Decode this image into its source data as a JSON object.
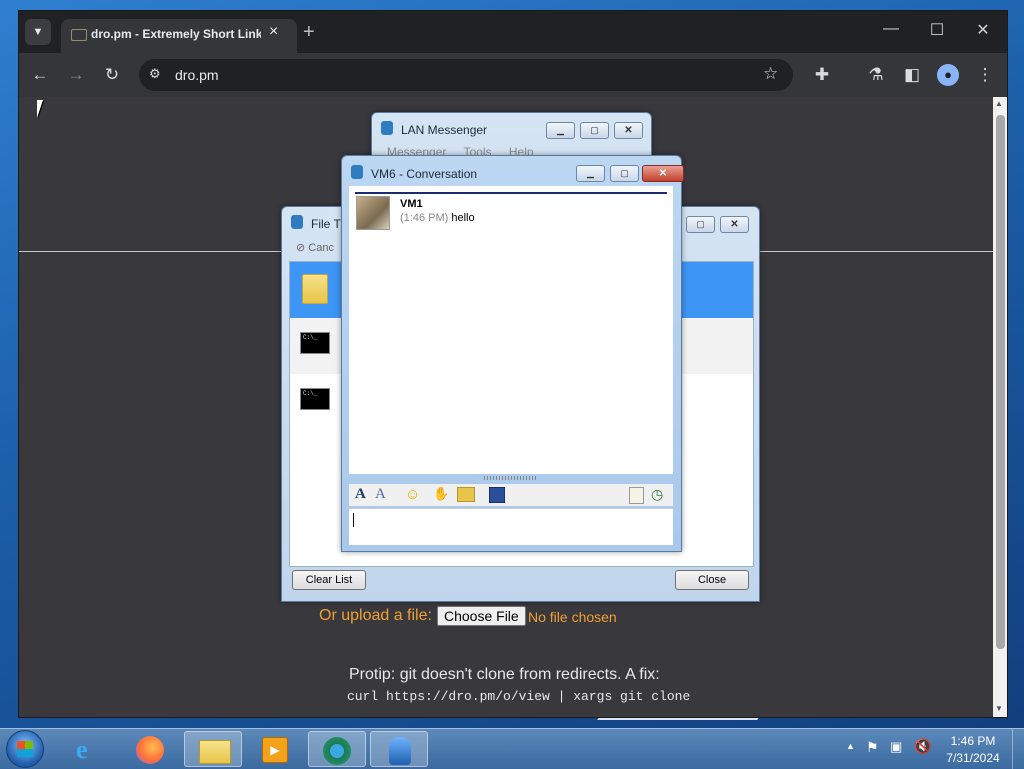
{
  "browser": {
    "tab_title": "dro.pm - Extremely Short Links",
    "url": "dro.pm",
    "tab_close": "×",
    "new_tab": "+"
  },
  "page": {
    "upload_label": "Or upload a file:",
    "choose_file": "Choose File",
    "no_file": "No file chosen",
    "protip": "Protip: git doesn't clone from redirects. A fix:",
    "command": "curl https://dro.pm/o/view | xargs git clone"
  },
  "lan_messenger": {
    "title": "LAN Messenger",
    "menu": [
      "Messenger",
      "Tools",
      "Help"
    ]
  },
  "file_transfer": {
    "title": "File Tr",
    "cancel": "Canc",
    "clear_list": "Clear List",
    "close": "Close"
  },
  "conversation": {
    "title": "VM6 - Conversation",
    "messages": [
      {
        "sender": "VM1",
        "time": "(1:46 PM)",
        "text": "hello"
      }
    ]
  },
  "taskbar": {
    "time": "1:46 PM",
    "date": "7/31/2024"
  },
  "colors": {
    "accent": "#3d95f5",
    "upload_text": "#f0a030",
    "chrome_bg": "#35363a"
  }
}
